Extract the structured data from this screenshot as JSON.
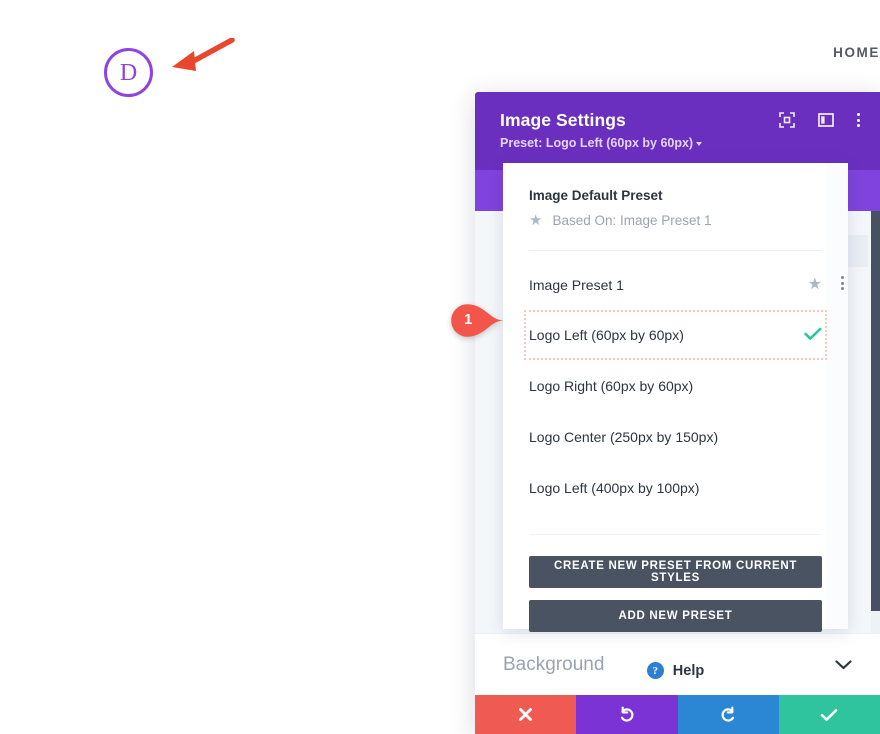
{
  "site": {
    "logo_letter": "D",
    "logo_icon": "divi-circle-logo",
    "nav_item": "HOME"
  },
  "annotation": {
    "arrow_icon": "red-arrow-pointing-left",
    "arrow_color": "#e8462d",
    "callout_number": "1",
    "callout_color": "#f2564a"
  },
  "modal": {
    "title": "Image Settings",
    "subtitle": "Preset: Logo Left (60px by 60px)",
    "header_color": "#6b2fbf",
    "tab_band_color": "#8043dd",
    "icons": [
      {
        "name": "focus-expand-icon"
      },
      {
        "name": "layout-panel-icon"
      },
      {
        "name": "more-vertical-icon"
      }
    ],
    "accordion": {
      "label": "Background",
      "chevron": "⌄"
    },
    "actions": [
      {
        "name": "discard-button",
        "icon": "close-x-icon",
        "color": "#ef5a52"
      },
      {
        "name": "undo-button",
        "icon": "undo-arrow-icon",
        "color": "#7b33d6"
      },
      {
        "name": "redo-button",
        "icon": "redo-arrow-icon",
        "color": "#2b87d4"
      },
      {
        "name": "save-button",
        "icon": "check-icon",
        "color": "#2fc39e"
      }
    ]
  },
  "preset_dropdown": {
    "default_preset_title": "Image Default Preset",
    "based_on_label": "Based On: Image Preset 1",
    "based_on_icon": "star-icon",
    "presets": [
      {
        "label": "Image Preset 1",
        "selected": false,
        "starred": true,
        "has_menu": true
      },
      {
        "label": "Logo Left (60px by 60px)",
        "selected": true,
        "starred": false,
        "has_menu": false
      },
      {
        "label": "Logo Right (60px by 60px)",
        "selected": false,
        "starred": false,
        "has_menu": false
      },
      {
        "label": "Logo Center (250px by 150px)",
        "selected": false,
        "starred": false,
        "has_menu": false
      },
      {
        "label": "Logo Left (400px by 100px)",
        "selected": false,
        "starred": false,
        "has_menu": false
      }
    ],
    "create_preset_button": "CREATE NEW PRESET FROM CURRENT STYLES",
    "add_preset_button": "ADD NEW PRESET",
    "help_label": "Help",
    "help_icon": "question-circle-icon",
    "selected_check_icon": "check-icon",
    "selected_check_color": "#2bc4a2",
    "highlight_border_color": "#f7c9c0"
  }
}
